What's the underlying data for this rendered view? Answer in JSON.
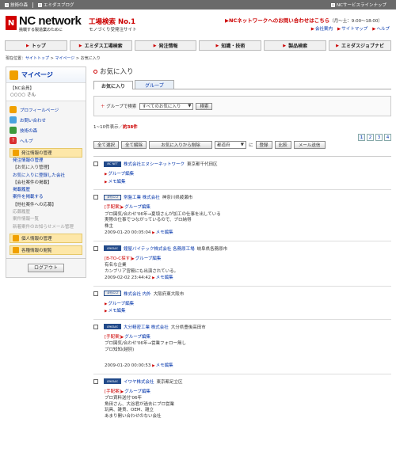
{
  "topbar": {
    "left": [
      "技術の森",
      "エミダスブログ"
    ],
    "right": "NCサービスラインナップ"
  },
  "header": {
    "logo_mark": "N",
    "logo_text": "NC network",
    "logo_sub": "挑戦する製造業のために",
    "catch_main": "工場検索 No.1",
    "catch_sub": "モノづくり受発注サイト",
    "contact": "NCネットワークへのお問い合わせはこちら",
    "contact_hours": "（月〜土：9:00〜18:00）",
    "links": [
      "会社案内",
      "サイトマップ",
      "ヘルプ"
    ]
  },
  "nav": [
    "トップ",
    "エミダス工場検索",
    "発注情報",
    "知識・技術",
    "製品検索",
    "エミダスジョブナビ"
  ],
  "breadcrumb": {
    "prefix": "現在位置：",
    "items": [
      "サイトトップ",
      "マイページ",
      "お気に入り"
    ]
  },
  "sidebar": {
    "title": "マイページ",
    "member_label": "【NC会員】",
    "member_name": "○○○○ さん",
    "links": [
      {
        "label": "プロフィールページ",
        "color": "#f0a000"
      },
      {
        "label": "お問い合わせ",
        "color": "#4aa3df"
      },
      {
        "label": "技術の森",
        "color": "#3c9a3c"
      },
      {
        "label": "ヘルプ",
        "color": "#d93030"
      }
    ],
    "section1": "発注情報の管理",
    "section1_items": [
      {
        "label": "発注情報の管理",
        "style": "b"
      },
      {
        "label": "【お気に入り管理】",
        "style": "t"
      },
      {
        "label": "お気に入りに登録した会社",
        "style": "b"
      },
      {
        "label": "【会社案件の掲載】",
        "style": "t"
      },
      {
        "label": "掲載履歴",
        "style": "b"
      },
      {
        "label": "案件を掲載する",
        "style": "b"
      },
      {
        "label": "【他社案件への応募】",
        "style": "t"
      },
      {
        "label": "応募履歴",
        "style": "g"
      },
      {
        "label": "案件情報一覧",
        "style": "g"
      },
      {
        "label": "新着案件のお知らせメール管理",
        "style": "g"
      }
    ],
    "section2": "個人情報の管理",
    "section3": "各種情報の閲覧",
    "logout": "ログアウト"
  },
  "main": {
    "title": "お気に入り",
    "tabs": [
      "お気に入り",
      "グループ"
    ],
    "group_label": "グループで検索",
    "group_select": "すべてのお気に入り",
    "group_button": "検索",
    "count_prefix": "1~10件表示／",
    "count_value": "約38件",
    "pages": [
      "1",
      "2",
      "3",
      "4"
    ],
    "actions": {
      "select_all": "全て選択",
      "clear_all": "全て解除",
      "delete": "お気に入りから削除",
      "pref_select": "都道府",
      "ni": "に",
      "register": "登録",
      "compare": "比較",
      "mail": "メール送信"
    },
    "items": [
      {
        "logo": "NC NET",
        "name": "株式会社エヌシーネットワーク",
        "addr": "東京都千代田区",
        "tag": "",
        "note": [],
        "date": "",
        "links": [
          "グループ編集",
          "メモ編集"
        ]
      },
      {
        "logo": "会社ロゴ",
        "name": "常盤工業 株式会社",
        "addr": "神奈川県綾瀬市",
        "tag": "[手配案]",
        "note": [
          "ブロ図気/合わせ'06年→夏頃さんが加工の仕事を出している",
          "実際の仕事でつながっているので、プロ納得",
          "株主"
        ],
        "date": "2009-01-20 00:05:04",
        "links": [
          "グループ編集",
          "メモ編集"
        ]
      },
      {
        "logo": "EMIDAS",
        "name": "鐘屋バイテック株式会社 各務原工場",
        "addr": "岐阜県各務原市",
        "tag": "[B-TO-C探す]",
        "note": [
          "有名な企業",
          "カンブリア宮殿にも出演されている。"
        ],
        "date": "2009-02-02 23:44:42",
        "links": [
          "グループ編集",
          "メモ編集"
        ]
      },
      {
        "logo": "会社ロゴ",
        "name": "株式会社 内外",
        "addr": "大阪府東大阪市",
        "tag": "",
        "note": [],
        "date": "",
        "links": [
          "グループ編集",
          "メモ編集"
        ]
      },
      {
        "logo": "EMIDAS",
        "name": "大分精密工業 株式会社",
        "addr": "大分県豊後高田市",
        "tag": "[手配案]",
        "note": [
          "ブロ図気/合わせ'06年→営業フォロー無し",
          "ブロ知知(越別)"
        ],
        "date": "2009-01-20 00:00:53",
        "links": [
          "グループ編集",
          "メモ編集"
        ]
      },
      {
        "logo": "EMIDAS",
        "name": "イワヤ株式会社",
        "addr": "東京都足立区",
        "tag": "[手配案]",
        "note": [
          "ブロ資料送付'06年",
          "角田さん、大谷君が過去にブロ営業",
          "玩具、雑貨、OEM、雑立",
          "あまり開い合わせのない会社"
        ],
        "date": "",
        "links": [
          "グループ編集"
        ]
      }
    ]
  }
}
